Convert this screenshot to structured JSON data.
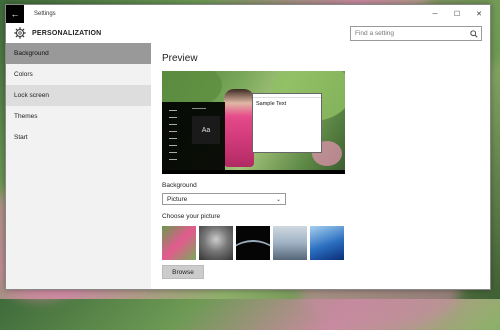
{
  "window": {
    "title": "Settings",
    "controls": {
      "minimize": "─",
      "maximize": "☐",
      "close": "✕"
    }
  },
  "header": {
    "title": "PERSONALIZATION",
    "search_placeholder": "Find a setting"
  },
  "sidebar": {
    "items": [
      {
        "label": "Background",
        "state": "selected"
      },
      {
        "label": "Colors",
        "state": "normal"
      },
      {
        "label": "Lock screen",
        "state": "hover"
      },
      {
        "label": "Themes",
        "state": "normal"
      },
      {
        "label": "Start",
        "state": "normal"
      }
    ]
  },
  "main": {
    "section_title": "Preview",
    "preview": {
      "tile_text": "Aa",
      "sample_window_text": "Sample Text"
    },
    "background_label": "Background",
    "background_value": "Picture",
    "choose_picture_label": "Choose your picture",
    "browse_label": "Browse"
  },
  "icons": {
    "back": "back-arrow-icon",
    "gear": "gear-icon",
    "search": "search-icon",
    "chevron": "chevron-down-icon"
  },
  "colors": {
    "sidebar_selected": "#999999",
    "sidebar_hover": "#dddddd",
    "titlebar_back": "#000000"
  }
}
